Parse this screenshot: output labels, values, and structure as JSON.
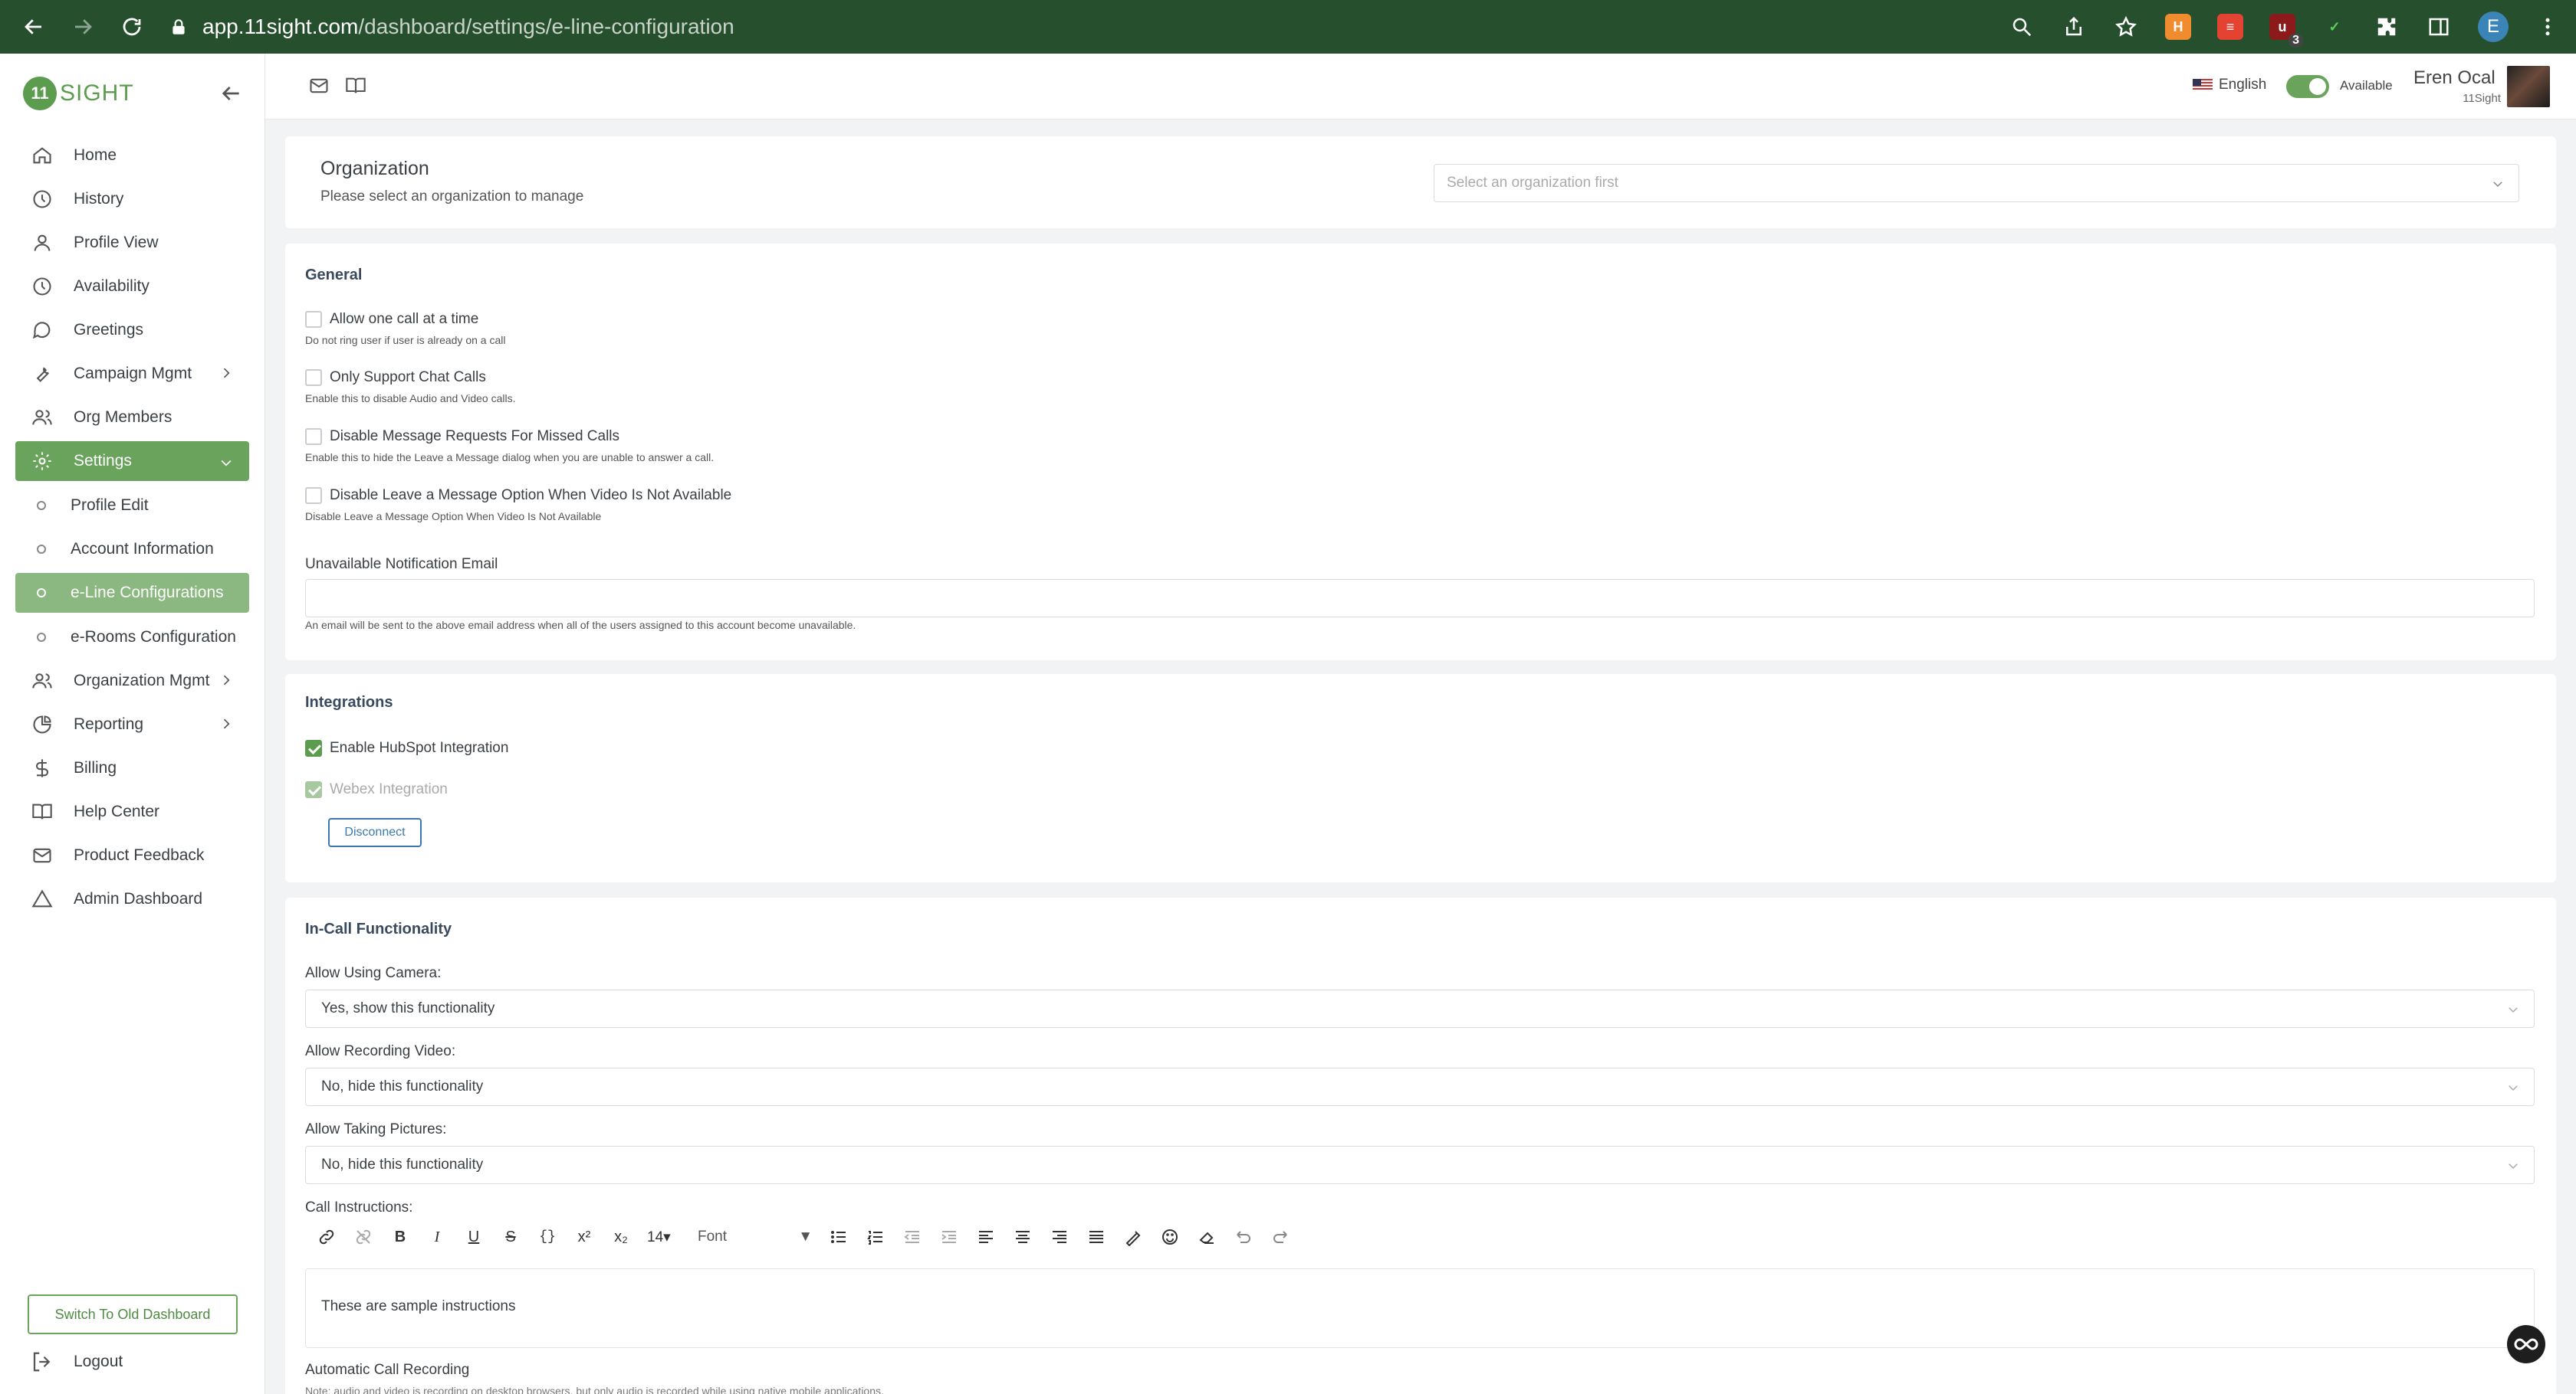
{
  "browser": {
    "url_domain": "app.11sight.com",
    "url_path": "/dashboard/settings/e-line-configuration",
    "ext_badge_count": "3",
    "profile_initial": "E"
  },
  "sidebar": {
    "logo_mark": "11",
    "logo_text": "SIGHT",
    "items": [
      {
        "label": "Home",
        "icon": "home-icon"
      },
      {
        "label": "History",
        "icon": "clock-icon"
      },
      {
        "label": "Profile View",
        "icon": "user-icon"
      },
      {
        "label": "Availability",
        "icon": "clock-icon"
      },
      {
        "label": "Greetings",
        "icon": "chat-bubble-icon"
      },
      {
        "label": "Campaign Mgmt",
        "icon": "wrench-icon"
      },
      {
        "label": "Org Members",
        "icon": "users-icon"
      },
      {
        "label": "Settings",
        "icon": "gear-icon"
      },
      {
        "label": "Profile Edit"
      },
      {
        "label": "Account Information"
      },
      {
        "label": "e-Line Configurations"
      },
      {
        "label": "e-Rooms Configuration"
      },
      {
        "label": "Organization Mgmt",
        "icon": "users-icon"
      },
      {
        "label": "Reporting",
        "icon": "pie-chart-icon"
      },
      {
        "label": "Billing",
        "icon": "dollar-icon"
      },
      {
        "label": "Help Center",
        "icon": "book-icon"
      },
      {
        "label": "Product Feedback",
        "icon": "mail-icon"
      },
      {
        "label": "Admin Dashboard",
        "icon": "triangle-icon"
      }
    ],
    "switch_button": "Switch To Old Dashboard",
    "logout": "Logout"
  },
  "topbar": {
    "language": "English",
    "availability_label": "Available",
    "availability_on": true,
    "user_name": "Eren Ocal",
    "user_org": "11Sight"
  },
  "organization": {
    "title": "Organization",
    "subtitle": "Please select an organization to manage",
    "select_placeholder": "Select an organization first"
  },
  "general": {
    "title": "General",
    "options": [
      {
        "label": "Allow one call at a time",
        "help": "Do not ring user if user is already on a call",
        "checked": false
      },
      {
        "label": "Only Support Chat Calls",
        "help": "Enable this to disable Audio and Video calls.",
        "checked": false
      },
      {
        "label": "Disable Message Requests For Missed Calls",
        "help": "Enable this to hide the Leave a Message dialog when you are unable to answer a call.",
        "checked": false
      },
      {
        "label": "Disable Leave a Message Option When Video Is Not Available",
        "help": "Disable Leave a Message Option When Video Is Not Available",
        "checked": false
      }
    ],
    "email_label": "Unavailable Notification Email",
    "email_value": "",
    "email_help": "An email will be sent to the above email address when all of the users assigned to this account become unavailable."
  },
  "integrations": {
    "title": "Integrations",
    "hubspot_label": "Enable HubSpot Integration",
    "webex_label": "Webex Integration",
    "disconnect_label": "Disconnect"
  },
  "in_call": {
    "title": "In-Call Functionality",
    "camera_label": "Allow Using Camera:",
    "camera_value": "Yes, show this functionality",
    "recording_label": "Allow Recording Video:",
    "recording_value": "No, hide this functionality",
    "pictures_label": "Allow Taking Pictures:",
    "pictures_value": "No, hide this functionality",
    "instructions_label": "Call Instructions:",
    "font_size": "14",
    "font_name": "Font",
    "instructions_text": "These are sample instructions",
    "auto_recording_label": "Automatic Call Recording",
    "auto_recording_note": "Note: audio and video is recording on desktop browsers, but only audio is recorded while using native mobile applications."
  },
  "colors": {
    "brand_green": "#6aa35c",
    "chrome_bg": "#26502d",
    "link_blue": "#3a78b0"
  }
}
